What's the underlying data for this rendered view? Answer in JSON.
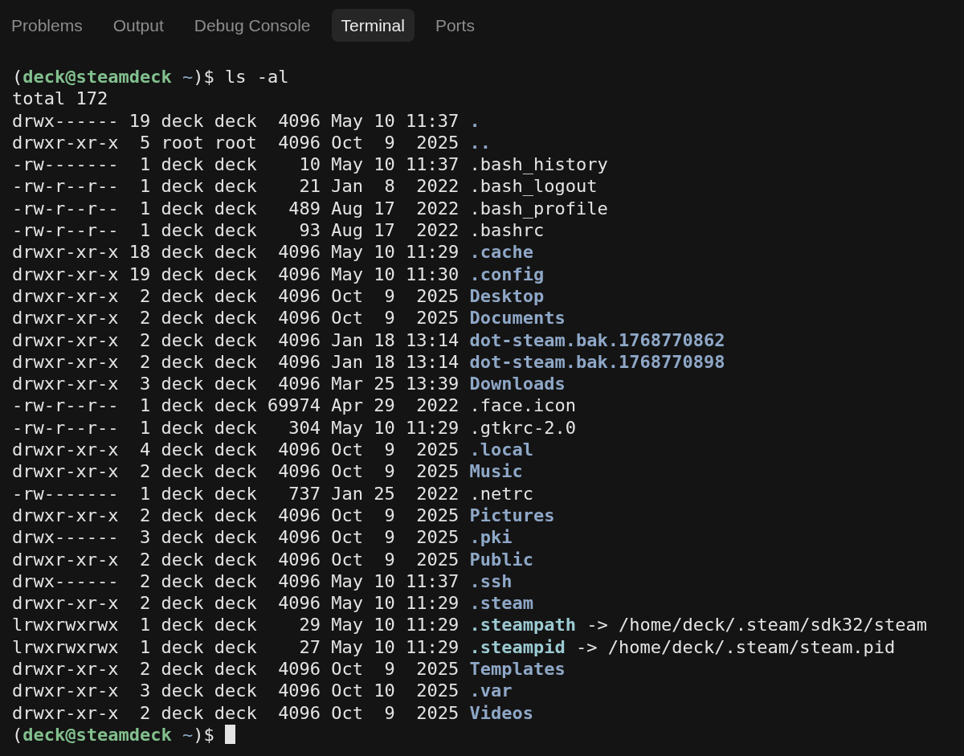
{
  "tabs": [
    {
      "label": "Problems",
      "selected": false
    },
    {
      "label": "Output",
      "selected": false
    },
    {
      "label": "Debug Console",
      "selected": false
    },
    {
      "label": "Terminal",
      "selected": true
    },
    {
      "label": "Ports",
      "selected": false
    }
  ],
  "terminal": {
    "prompt": {
      "open": "(",
      "user_host": "deck@steamdeck",
      "cwd": "~",
      "close": ")$"
    },
    "final_prompt": {
      "open": "(",
      "user_host": "deck@steamdeck",
      "cwd": "~",
      "close": ")$"
    },
    "command": "ls -al",
    "total": "total 172",
    "entries": [
      {
        "info": "drwx------ 19 deck deck  4096 May 10 11:37",
        "name": ".",
        "kind": "dir"
      },
      {
        "info": "drwxr-xr-x  5 root root  4096 Oct  9  2025",
        "name": "..",
        "kind": "dir"
      },
      {
        "info": "-rw-------  1 deck deck    10 May 10 11:37",
        "name": ".bash_history",
        "kind": "file"
      },
      {
        "info": "-rw-r--r--  1 deck deck    21 Jan  8  2022",
        "name": ".bash_logout",
        "kind": "file"
      },
      {
        "info": "-rw-r--r--  1 deck deck   489 Aug 17  2022",
        "name": ".bash_profile",
        "kind": "file"
      },
      {
        "info": "-rw-r--r--  1 deck deck    93 Aug 17  2022",
        "name": ".bashrc",
        "kind": "file"
      },
      {
        "info": "drwxr-xr-x 18 deck deck  4096 May 10 11:29",
        "name": ".cache",
        "kind": "dir"
      },
      {
        "info": "drwxr-xr-x 19 deck deck  4096 May 10 11:30",
        "name": ".config",
        "kind": "dir"
      },
      {
        "info": "drwxr-xr-x  2 deck deck  4096 Oct  9  2025",
        "name": "Desktop",
        "kind": "dir"
      },
      {
        "info": "drwxr-xr-x  2 deck deck  4096 Oct  9  2025",
        "name": "Documents",
        "kind": "dir"
      },
      {
        "info": "drwxr-xr-x  2 deck deck  4096 Jan 18 13:14",
        "name": "dot-steam.bak.1768770862",
        "kind": "dir"
      },
      {
        "info": "drwxr-xr-x  2 deck deck  4096 Jan 18 13:14",
        "name": "dot-steam.bak.1768770898",
        "kind": "dir"
      },
      {
        "info": "drwxr-xr-x  3 deck deck  4096 Mar 25 13:39",
        "name": "Downloads",
        "kind": "dir"
      },
      {
        "info": "-rw-r--r--  1 deck deck 69974 Apr 29  2022",
        "name": ".face.icon",
        "kind": "file"
      },
      {
        "info": "-rw-r--r--  1 deck deck   304 May 10 11:29",
        "name": ".gtkrc-2.0",
        "kind": "file"
      },
      {
        "info": "drwxr-xr-x  4 deck deck  4096 Oct  9  2025",
        "name": ".local",
        "kind": "dir"
      },
      {
        "info": "drwxr-xr-x  2 deck deck  4096 Oct  9  2025",
        "name": "Music",
        "kind": "dir"
      },
      {
        "info": "-rw-------  1 deck deck   737 Jan 25  2022",
        "name": ".netrc",
        "kind": "file"
      },
      {
        "info": "drwxr-xr-x  2 deck deck  4096 Oct  9  2025",
        "name": "Pictures",
        "kind": "dir"
      },
      {
        "info": "drwx------  3 deck deck  4096 Oct  9  2025",
        "name": ".pki",
        "kind": "dir"
      },
      {
        "info": "drwxr-xr-x  2 deck deck  4096 Oct  9  2025",
        "name": "Public",
        "kind": "dir"
      },
      {
        "info": "drwx------  2 deck deck  4096 May 10 11:37",
        "name": ".ssh",
        "kind": "dir"
      },
      {
        "info": "drwxr-xr-x  2 deck deck  4096 May 10 11:29",
        "name": ".steam",
        "kind": "dir"
      },
      {
        "info": "lrwxrwxrwx  1 deck deck    29 May 10 11:29",
        "name": ".steampath",
        "kind": "link",
        "target": "-> /home/deck/.steam/sdk32/steam"
      },
      {
        "info": "lrwxrwxrwx  1 deck deck    27 May 10 11:29",
        "name": ".steampid",
        "kind": "link",
        "target": "-> /home/deck/.steam/steam.pid"
      },
      {
        "info": "drwxr-xr-x  2 deck deck  4096 Oct  9  2025",
        "name": "Templates",
        "kind": "dir"
      },
      {
        "info": "drwxr-xr-x  3 deck deck  4096 Oct 10  2025",
        "name": ".var",
        "kind": "dir"
      },
      {
        "info": "drwxr-xr-x  2 deck deck  4096 Oct  9  2025",
        "name": "Videos",
        "kind": "dir"
      }
    ]
  }
}
